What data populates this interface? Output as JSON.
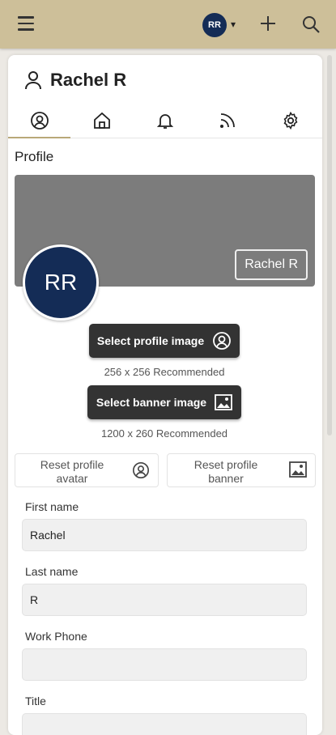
{
  "topbar": {
    "avatar_initials": "RR",
    "caret": "▾"
  },
  "profile": {
    "name": "Rachel R",
    "section_title": "Profile",
    "banner_name": "Rachel R",
    "avatar_initials": "RR"
  },
  "tabs": [
    {
      "id": "profile",
      "icon": "user-circle-icon",
      "active": true
    },
    {
      "id": "home",
      "icon": "home-icon"
    },
    {
      "id": "notifications",
      "icon": "bell-icon"
    },
    {
      "id": "feed",
      "icon": "rss-icon"
    },
    {
      "id": "settings",
      "icon": "gear-icon"
    }
  ],
  "actions": {
    "select_profile_image": "Select profile image",
    "profile_image_hint": "256 x 256 Recommended",
    "select_banner_image": "Select banner image",
    "banner_image_hint": "1200 x 260 Recommended",
    "reset_avatar_line1": "Reset profile",
    "reset_avatar_line2": "avatar",
    "reset_banner_line1": "Reset profile",
    "reset_banner_line2": "banner"
  },
  "form": {
    "first_name_label": "First name",
    "first_name_value": "Rachel",
    "last_name_label": "Last name",
    "last_name_value": "R",
    "work_phone_label": "Work Phone",
    "work_phone_value": "",
    "title_label": "Title",
    "title_value": ""
  },
  "colors": {
    "topbar": "#cdbf99",
    "avatar": "#142c56",
    "dark_button": "#333333",
    "banner": "#7c7c7c",
    "tab_underline": "#b9a878"
  }
}
